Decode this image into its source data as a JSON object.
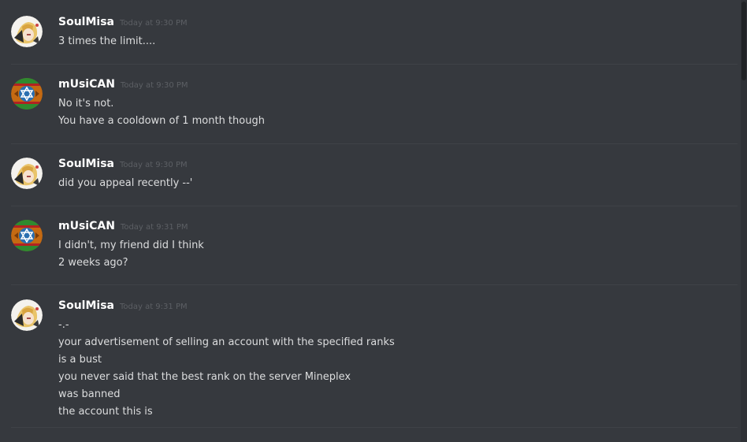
{
  "messages": [
    {
      "author": "SoulMisa",
      "timestamp": "Today at 9:30 PM",
      "avatar": "soulmisa-avatar",
      "lines": [
        "3 times the limit...."
      ]
    },
    {
      "author": "mUsiCAN",
      "timestamp": "Today at 9:30 PM",
      "avatar": "musican-avatar",
      "lines": [
        "No it's not.",
        "You have a cooldown of 1 month though"
      ]
    },
    {
      "author": "SoulMisa",
      "timestamp": "Today at 9:30 PM",
      "avatar": "soulmisa-avatar",
      "lines": [
        "did you appeal recently --'"
      ]
    },
    {
      "author": "mUsiCAN",
      "timestamp": "Today at 9:31 PM",
      "avatar": "musican-avatar",
      "lines": [
        "I didn't, my friend did I think",
        "2 weeks ago?"
      ]
    },
    {
      "author": "SoulMisa",
      "timestamp": "Today at 9:31 PM",
      "avatar": "soulmisa-avatar",
      "lines": [
        "-.-",
        "your advertisement of selling an account with the specified ranks",
        "is a bust",
        "you never said that the best rank on the server Mineplex",
        "was banned",
        "the account this is"
      ]
    }
  ],
  "colors": {
    "background": "#36393e",
    "username": "#ffffff",
    "message_text": "#dcddde",
    "timestamp": "#5c5f64",
    "divider": "#3f4247"
  }
}
